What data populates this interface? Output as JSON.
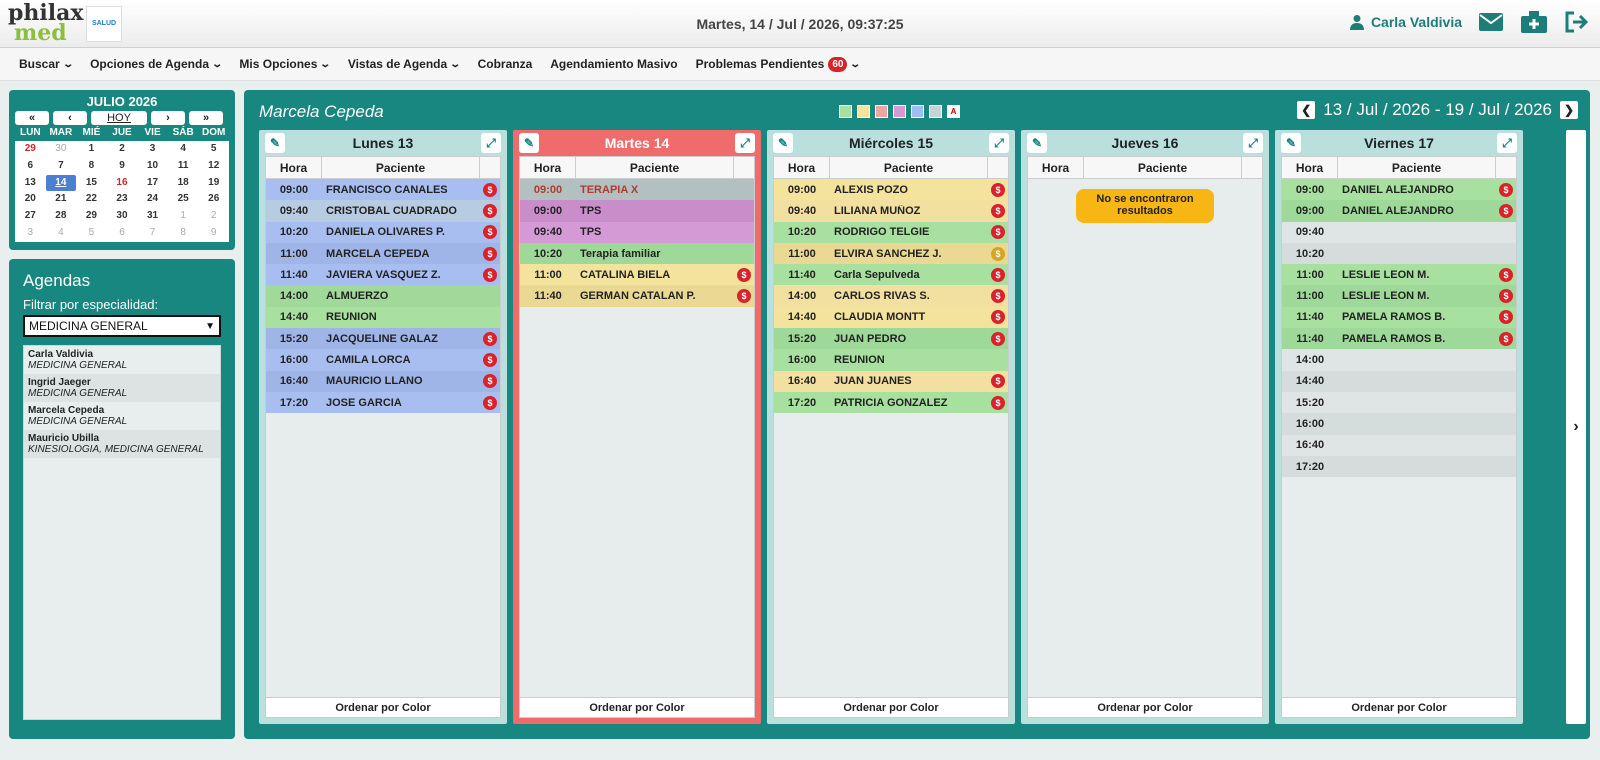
{
  "brand": {
    "logo_line1": "philax",
    "logo_line2": "med",
    "partner_badge": "SALUD"
  },
  "header": {
    "datetime": "Martes, 14 / Jul / 2026, 09:37:25",
    "user": "Carla Valdivia"
  },
  "menu": [
    {
      "label": "Buscar",
      "caret": true
    },
    {
      "label": "Opciones de Agenda",
      "caret": true
    },
    {
      "label": "Mis Opciones",
      "caret": true
    },
    {
      "label": "Vistas de Agenda",
      "caret": true
    },
    {
      "label": "Cobranza",
      "caret": false
    },
    {
      "label": "Agendamiento Masivo",
      "caret": false
    },
    {
      "label": "Problemas Pendientes",
      "caret": true,
      "badge": "60"
    }
  ],
  "calendar": {
    "title": "JULIO 2026",
    "today_label": "HOY",
    "weekdays": [
      "LUN",
      "MAR",
      "MIÉ",
      "JUE",
      "VIE",
      "SÁB",
      "DOM"
    ],
    "days": [
      {
        "d": "29",
        "t": "red"
      },
      {
        "d": "30",
        "t": "muted"
      },
      {
        "d": "1"
      },
      {
        "d": "2"
      },
      {
        "d": "3"
      },
      {
        "d": "4"
      },
      {
        "d": "5"
      },
      {
        "d": "6"
      },
      {
        "d": "7"
      },
      {
        "d": "8"
      },
      {
        "d": "9"
      },
      {
        "d": "10"
      },
      {
        "d": "11"
      },
      {
        "d": "12"
      },
      {
        "d": "13"
      },
      {
        "d": "14",
        "t": "today"
      },
      {
        "d": "15"
      },
      {
        "d": "16",
        "t": "red"
      },
      {
        "d": "17"
      },
      {
        "d": "18"
      },
      {
        "d": "19"
      },
      {
        "d": "20"
      },
      {
        "d": "21"
      },
      {
        "d": "22"
      },
      {
        "d": "23"
      },
      {
        "d": "24"
      },
      {
        "d": "25"
      },
      {
        "d": "26"
      },
      {
        "d": "27"
      },
      {
        "d": "28"
      },
      {
        "d": "29"
      },
      {
        "d": "30"
      },
      {
        "d": "31"
      },
      {
        "d": "1",
        "t": "muted"
      },
      {
        "d": "2",
        "t": "muted"
      },
      {
        "d": "3",
        "t": "muted"
      },
      {
        "d": "4",
        "t": "muted"
      },
      {
        "d": "5",
        "t": "muted"
      },
      {
        "d": "6",
        "t": "muted"
      },
      {
        "d": "7",
        "t": "muted"
      },
      {
        "d": "8",
        "t": "muted"
      },
      {
        "d": "9",
        "t": "muted"
      }
    ]
  },
  "agendas": {
    "title": "Agendas",
    "filter_label": "Filtrar por especialidad:",
    "selected": "MEDICINA GENERAL",
    "items": [
      {
        "name": "Carla Valdivia",
        "spec": "MEDICINA GENERAL"
      },
      {
        "name": "Ingrid Jaeger",
        "spec": "MEDICINA GENERAL"
      },
      {
        "name": "Marcela Cepeda",
        "spec": "MEDICINA GENERAL"
      },
      {
        "name": "Mauricio Ubilla",
        "spec": "KINESIOLOGIA, MEDICINA GENERAL"
      }
    ]
  },
  "panel": {
    "doctor": "Marcela Cepeda",
    "range": "13 / Jul / 2026 - 19 / Jul / 2026",
    "swatch_colors": [
      "#a8e0a0",
      "#f3e39d",
      "#f2a3a3",
      "#d49ad6",
      "#9fbdee",
      "#c5d5d3"
    ],
    "swatch_letter": "A",
    "col_hora": "Hora",
    "col_paciente": "Paciente",
    "sort_label": "Ordenar por Color",
    "no_results": "No se encontraron resultados"
  },
  "days": [
    {
      "title": "Lunes 13",
      "today": false,
      "rows": [
        {
          "h": "09:00",
          "p": "FRANCISCO CANALES",
          "bg": "#a9bef0",
          "pay": "red"
        },
        {
          "h": "09:40",
          "p": "CRISTOBAL CUADRADO",
          "bg": "#b7cce0",
          "pay": "red"
        },
        {
          "h": "10:20",
          "p": "DANIELA OLIVARES P.",
          "bg": "#a9bef0",
          "pay": "red"
        },
        {
          "h": "11:00",
          "p": "MARCELA CEPEDA",
          "bg": "#9fb5e8",
          "pay": "red"
        },
        {
          "h": "11:40",
          "p": "JAVIERA VASQUEZ Z.",
          "bg": "#a9bef0",
          "pay": "red"
        },
        {
          "h": "14:00",
          "p": "ALMUERZO",
          "bg": "#a0d99a",
          "pay": ""
        },
        {
          "h": "14:40",
          "p": "REUNION",
          "bg": "#a8e0a0",
          "pay": ""
        },
        {
          "h": "15:20",
          "p": "JACQUELINE GALAZ",
          "bg": "#9fb5e8",
          "pay": "red"
        },
        {
          "h": "16:00",
          "p": "CAMILA LORCA",
          "bg": "#a9bef0",
          "pay": "red"
        },
        {
          "h": "16:40",
          "p": "MAURICIO LLANO",
          "bg": "#9fb5e8",
          "pay": "red"
        },
        {
          "h": "17:20",
          "p": "JOSE GARCIA",
          "bg": "#a9bef0",
          "pay": "red"
        }
      ]
    },
    {
      "title": "Martes 14",
      "today": true,
      "rows": [
        {
          "h": "09:00",
          "p": "TERAPIA X",
          "bg": "#b3c0c0",
          "pay": "",
          "fg": "#b03a2e"
        },
        {
          "h": "09:00",
          "p": "TPS",
          "bg": "#c98ec9",
          "pay": ""
        },
        {
          "h": "09:40",
          "p": "TPS",
          "bg": "#d49ad6",
          "pay": ""
        },
        {
          "h": "10:20",
          "p": "Terapia familiar",
          "bg": "#9fd99a",
          "pay": ""
        },
        {
          "h": "11:00",
          "p": "CATALINA BIELA",
          "bg": "#f3e39d",
          "pay": "red"
        },
        {
          "h": "11:40",
          "p": "GERMAN CATALAN P.",
          "bg": "#ead993",
          "pay": "red"
        }
      ]
    },
    {
      "title": "Miércoles 15",
      "today": false,
      "rows": [
        {
          "h": "09:00",
          "p": "ALEXIS POZO",
          "bg": "#f3e39d",
          "pay": "red"
        },
        {
          "h": "09:40",
          "p": "LILIANA MUÑOZ",
          "bg": "#f1e0a0",
          "pay": "red"
        },
        {
          "h": "10:20",
          "p": "RODRIGO TELGIE",
          "bg": "#a8e0a0",
          "pay": "red"
        },
        {
          "h": "11:00",
          "p": "ELVIRA SANCHEZ J.",
          "bg": "#ead993",
          "pay": "amber"
        },
        {
          "h": "11:40",
          "p": "Carla Sepulveda",
          "bg": "#a8e0a0",
          "pay": "red"
        },
        {
          "h": "14:00",
          "p": "CARLOS RIVAS S.",
          "bg": "#f1e0a0",
          "pay": "red"
        },
        {
          "h": "14:40",
          "p": "CLAUDIA MONTT",
          "bg": "#f3e39d",
          "pay": "red"
        },
        {
          "h": "15:20",
          "p": "JUAN PEDRO",
          "bg": "#9fd99a",
          "pay": "red"
        },
        {
          "h": "16:00",
          "p": "REUNION",
          "bg": "#a8e0a0",
          "pay": ""
        },
        {
          "h": "16:40",
          "p": "JUAN JUANES",
          "bg": "#f1e0a0",
          "pay": "red"
        },
        {
          "h": "17:20",
          "p": "PATRICIA GONZALEZ",
          "bg": "#a8e0a0",
          "pay": "red"
        }
      ]
    },
    {
      "title": "Jueves 16",
      "today": false,
      "rows": [],
      "empty": true
    },
    {
      "title": "Viernes 17",
      "today": false,
      "rows": [
        {
          "h": "09:00",
          "p": "DANIEL ALEJANDRO",
          "bg": "#a8e0a0",
          "pay": "red"
        },
        {
          "h": "09:00",
          "p": "DANIEL ALEJANDRO",
          "bg": "#9fd99a",
          "pay": "red"
        },
        {
          "h": "09:40",
          "p": "",
          "bg": "#dfe5e5",
          "pay": ""
        },
        {
          "h": "10:20",
          "p": "",
          "bg": "#d4dcdc",
          "pay": ""
        },
        {
          "h": "11:00",
          "p": "LESLIE LEON M.",
          "bg": "#a8e0a0",
          "pay": "red"
        },
        {
          "h": "11:00",
          "p": "LESLIE LEON M.",
          "bg": "#9fd99a",
          "pay": "red"
        },
        {
          "h": "11:40",
          "p": "PAMELA RAMOS B.",
          "bg": "#a8e0a0",
          "pay": "red"
        },
        {
          "h": "11:40",
          "p": "PAMELA RAMOS B.",
          "bg": "#9fd99a",
          "pay": "red"
        },
        {
          "h": "14:00",
          "p": "",
          "bg": "#dfe5e5",
          "pay": ""
        },
        {
          "h": "14:40",
          "p": "",
          "bg": "#d4dcdc",
          "pay": ""
        },
        {
          "h": "15:20",
          "p": "",
          "bg": "#dfe5e5",
          "pay": ""
        },
        {
          "h": "16:00",
          "p": "",
          "bg": "#d4dcdc",
          "pay": ""
        },
        {
          "h": "16:40",
          "p": "",
          "bg": "#dfe5e5",
          "pay": ""
        },
        {
          "h": "17:20",
          "p": "",
          "bg": "#d4dcdc",
          "pay": ""
        }
      ]
    }
  ]
}
